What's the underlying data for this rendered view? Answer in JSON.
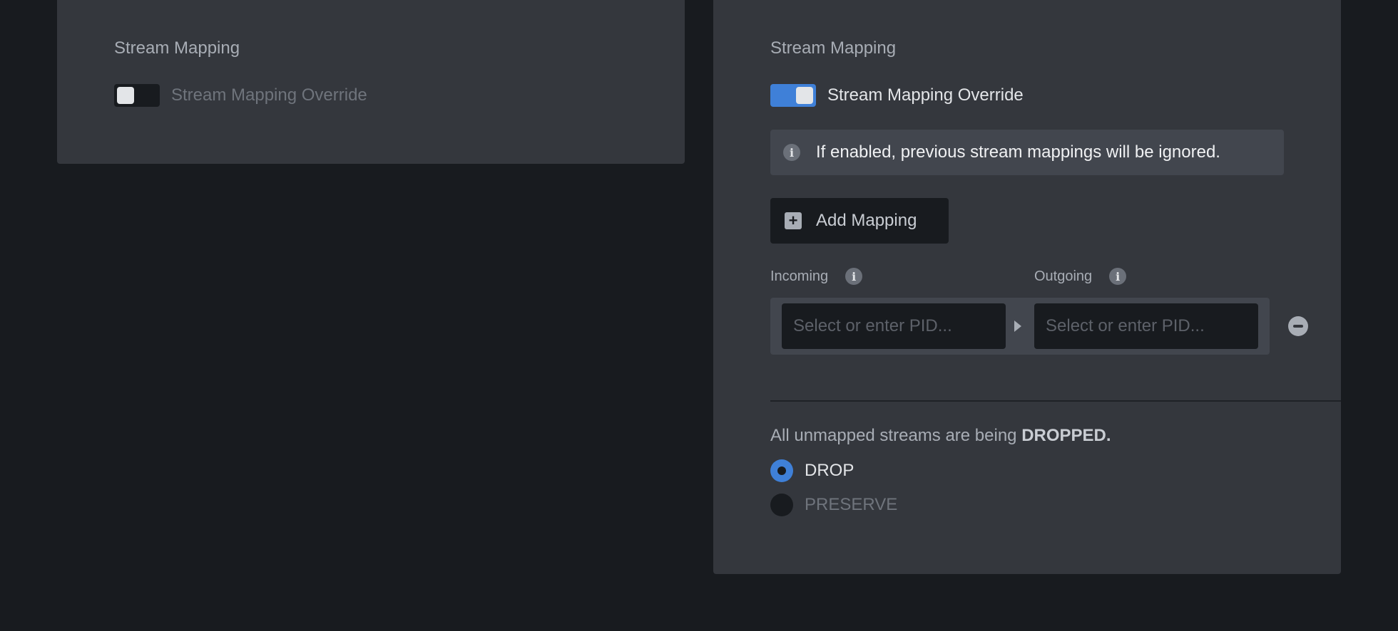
{
  "left_panel": {
    "title": "Stream Mapping",
    "override_label": "Stream Mapping Override",
    "override_enabled": false
  },
  "right_panel": {
    "title": "Stream Mapping",
    "override_label": "Stream Mapping Override",
    "override_enabled": true,
    "info_text": "If enabled, previous stream mappings will be ignored.",
    "add_mapping_label": "Add Mapping",
    "incoming_label": "Incoming",
    "outgoing_label": "Outgoing",
    "incoming_placeholder": "Select or enter PID...",
    "outgoing_placeholder": "Select or enter PID...",
    "summary_prefix": "All unmapped streams are being",
    "summary_value": "DROPPED.",
    "options": [
      {
        "label": "DROP",
        "selected": true
      },
      {
        "label": "PRESERVE",
        "selected": false
      }
    ]
  },
  "colors": {
    "accent": "#3f80d8",
    "panel": "#34373d",
    "background": "#181b1f"
  }
}
